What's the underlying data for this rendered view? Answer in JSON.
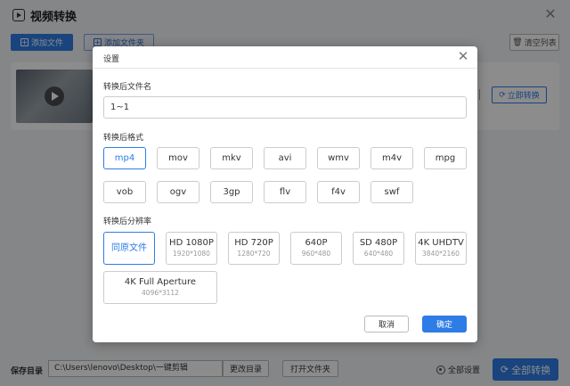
{
  "app": {
    "title": "视频转换"
  },
  "toolbar": {
    "add_file": "添加文件",
    "add_folder": "添加文件夹",
    "clear_list": "清空列表"
  },
  "file_row": {
    "convert_now": "立即转换"
  },
  "bottom": {
    "save_dir_label": "保存目录",
    "save_path": "C:\\Users\\lenovo\\Desktop\\一键剪辑",
    "change_dir": "更改目录",
    "open_folder": "打开文件夹",
    "all_settings": "全部设置",
    "convert_all": "全部转换"
  },
  "dialog": {
    "title": "设置",
    "filename_label": "转换后文件名",
    "filename_value": "1~1",
    "format_label": "转换后格式",
    "formats": [
      "mp4",
      "mov",
      "mkv",
      "avi",
      "wmv",
      "m4v",
      "mpg",
      "vob",
      "ogv",
      "3gp",
      "flv",
      "f4v",
      "swf"
    ],
    "selected_format": "mp4",
    "resolution_label": "转换后分辨率",
    "resolutions": [
      {
        "name": "同原文件",
        "dim": ""
      },
      {
        "name": "HD 1080P",
        "dim": "1920*1080"
      },
      {
        "name": "HD 720P",
        "dim": "1280*720"
      },
      {
        "name": "640P",
        "dim": "960*480"
      },
      {
        "name": "SD 480P",
        "dim": "640*480"
      },
      {
        "name": "4K UHDTV",
        "dim": "3840*2160"
      },
      {
        "name": "4K Full Aperture",
        "dim": "4096*3112"
      }
    ],
    "selected_resolution": "同原文件",
    "cancel": "取消",
    "confirm": "确定"
  },
  "colors": {
    "accent": "#2e7ce6",
    "overlay": "rgba(0,0,0,0.45)"
  }
}
